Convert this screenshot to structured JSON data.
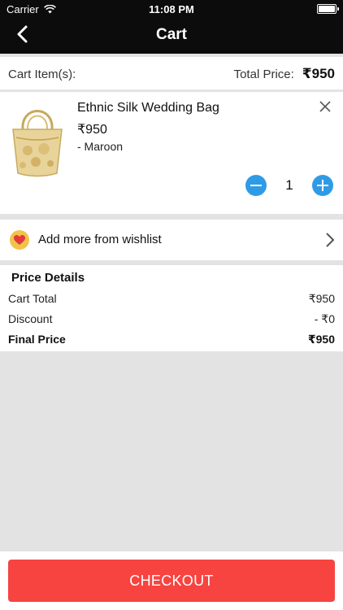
{
  "status_bar": {
    "carrier": "Carrier",
    "time": "11:08 PM"
  },
  "nav": {
    "title": "Cart"
  },
  "summary": {
    "cart_items_label": "Cart Item(s):",
    "total_label": "Total Price:",
    "total_value": "₹950"
  },
  "item": {
    "name": "Ethnic Silk Wedding Bag",
    "price": "₹950",
    "variant": "- Maroon",
    "quantity": "1"
  },
  "wishlist": {
    "label": "Add more from wishlist"
  },
  "price_details": {
    "title": "Price Details",
    "rows": [
      {
        "label": "Cart Total",
        "value": "₹950"
      },
      {
        "label": "Discount",
        "value": "- ₹0"
      },
      {
        "label": "Final Price",
        "value": "₹950"
      }
    ]
  },
  "checkout": {
    "label": "CHECKOUT"
  },
  "colors": {
    "accent_blue": "#2f9be6",
    "checkout_red": "#f74441",
    "nav_bg": "#0c0c0c"
  }
}
